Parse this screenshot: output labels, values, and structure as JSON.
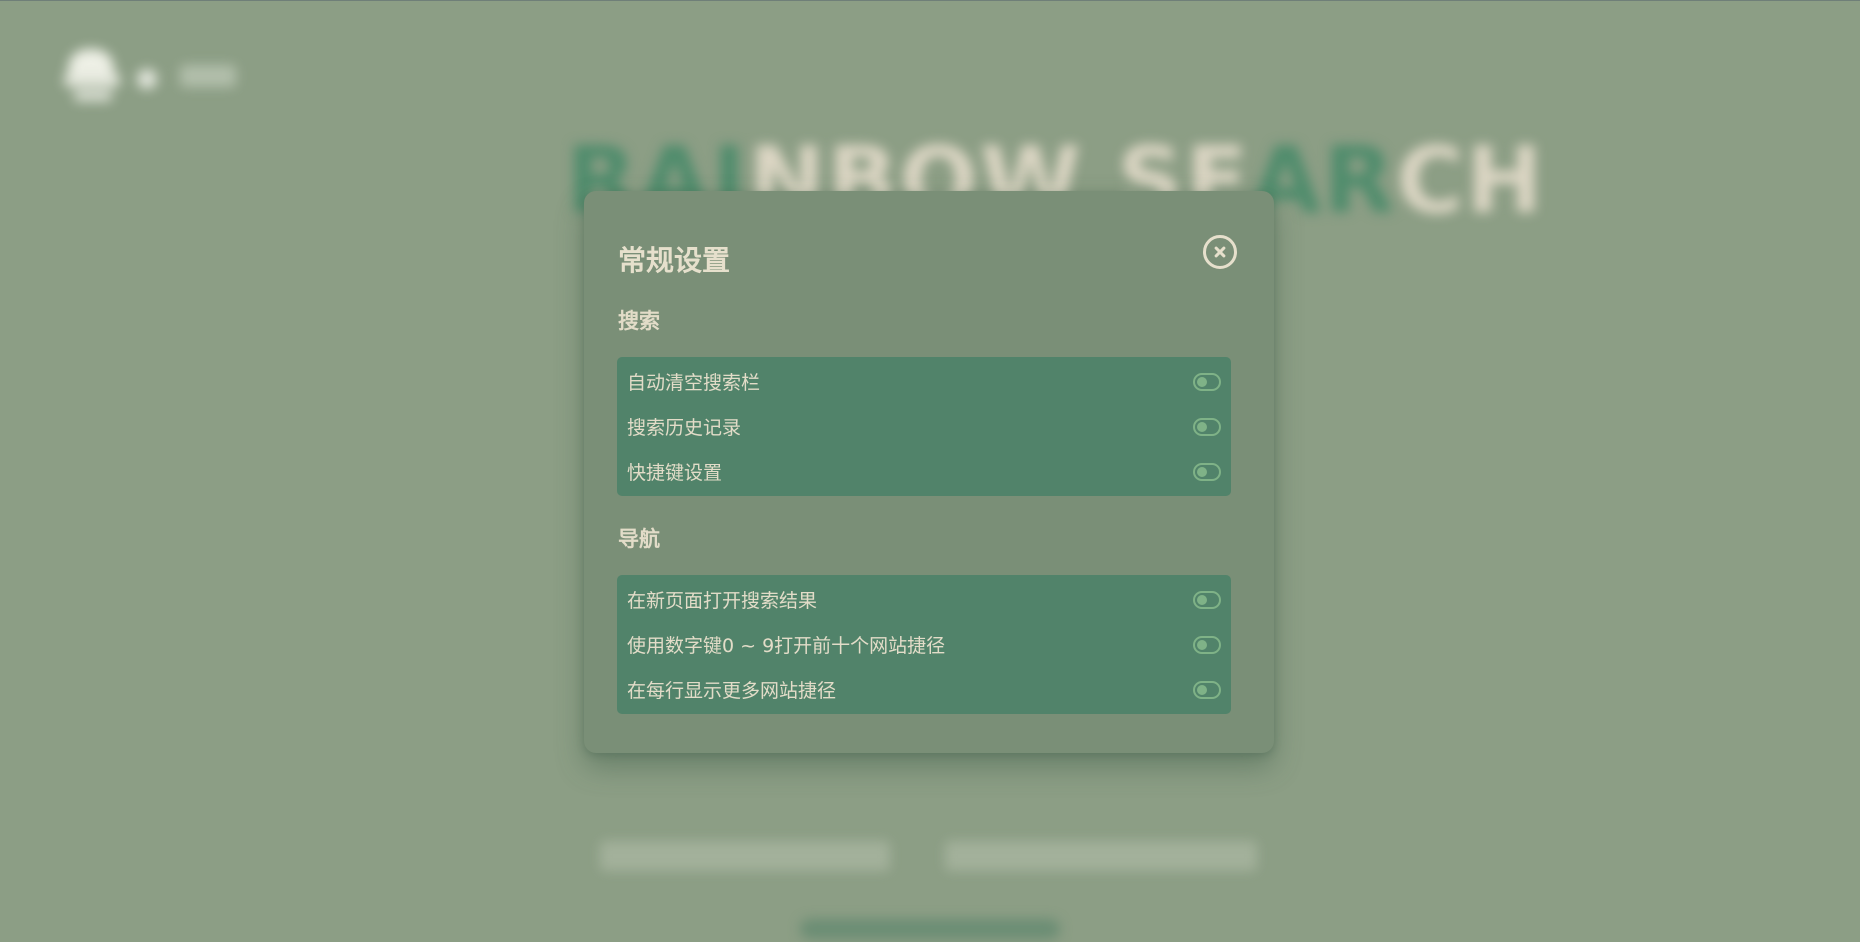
{
  "dialog": {
    "title": "常规设置",
    "close_icon": "close-circle-icon"
  },
  "sections": [
    {
      "title": "搜索",
      "items": [
        {
          "label": "自动清空搜索栏",
          "enabled": false
        },
        {
          "label": "搜索历史记录",
          "enabled": false
        },
        {
          "label": "快捷键设置",
          "enabled": false
        }
      ]
    },
    {
      "title": "导航",
      "items": [
        {
          "label": "在新页面打开搜索结果",
          "enabled": false
        },
        {
          "label": "使用数字键0 ~ 9打开前十个网站捷径",
          "enabled": false
        },
        {
          "label": "在每行显示更多网站捷径",
          "enabled": false
        }
      ]
    }
  ],
  "colors": {
    "page_background": "#8c9e85",
    "dialog_background": "#7a8f77",
    "section_background": "#51836a",
    "text": "#e2dcc8",
    "toggle": "#7fb287"
  }
}
